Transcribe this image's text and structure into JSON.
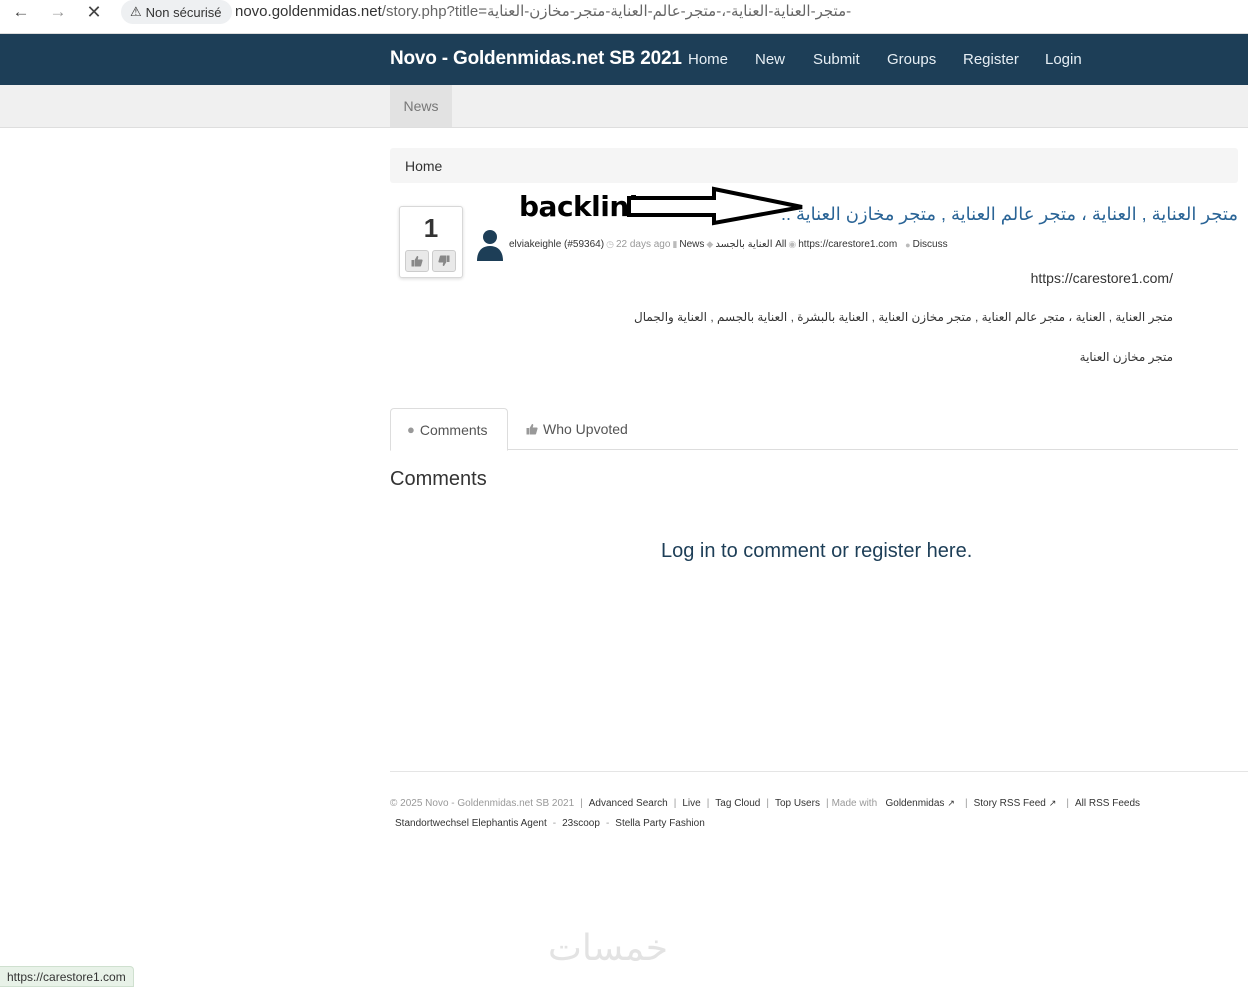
{
  "browser": {
    "security_label": "Non sécurisé",
    "url_host": "novo.goldenmidas.net",
    "url_path": "/story.php?title=متجر-العناية-العناية-،-متجر-عالم-العناية-متجر-مخازن-العناية-"
  },
  "site": {
    "brand": "Novo - Goldenmidas.net SB 2021",
    "nav": [
      "Home",
      "New",
      "Submit",
      "Groups",
      "Register",
      "Login"
    ],
    "sub_nav_news": "News"
  },
  "breadcrumb": {
    "home": "Home"
  },
  "story": {
    "votes": "1",
    "annotation": "backlink",
    "title": "متجر العناية , العناية ، متجر عالم العناية , متجر مخازن العناية ..",
    "author": "elviakeighle (#59364)",
    "time_ago": "22 days ago",
    "category": "News",
    "tags": "العناية بالجسد All",
    "link": "https://carestore1.com",
    "discuss": "Discuss",
    "body_url": "https://carestore1.com/",
    "body_line2": "متجر العناية , العناية ، متجر عالم العناية , متجر مخازن العناية , العناية بالبشرة , العناية بالجسم , العناية والجمال",
    "body_line3": "متجر مخازن العناية"
  },
  "tabs": {
    "comments": "Comments",
    "who_upvoted": "Who Upvoted"
  },
  "comments": {
    "heading": "Comments",
    "login_prompt": "Log in to comment or register here."
  },
  "footer": {
    "copyright": "© 2025 Novo - Goldenmidas.net SB 2021",
    "advanced_search": "Advanced Search",
    "live": "Live",
    "tag_cloud": "Tag Cloud",
    "top_users": "Top Users",
    "made_with": "Made with",
    "goldenmidas": "Goldenmidas",
    "story_rss": "Story RSS Feed",
    "all_rss": "All RSS Feeds",
    "link1": "Standortwechsel Elephantis Agent",
    "link2": "23scoop",
    "link3": "Stella Party Fashion"
  },
  "watermark": "خمسات",
  "status_url": "https://carestore1.com",
  "colors": {
    "navbar": "#1d3e57",
    "title_link": "#2a6496"
  }
}
